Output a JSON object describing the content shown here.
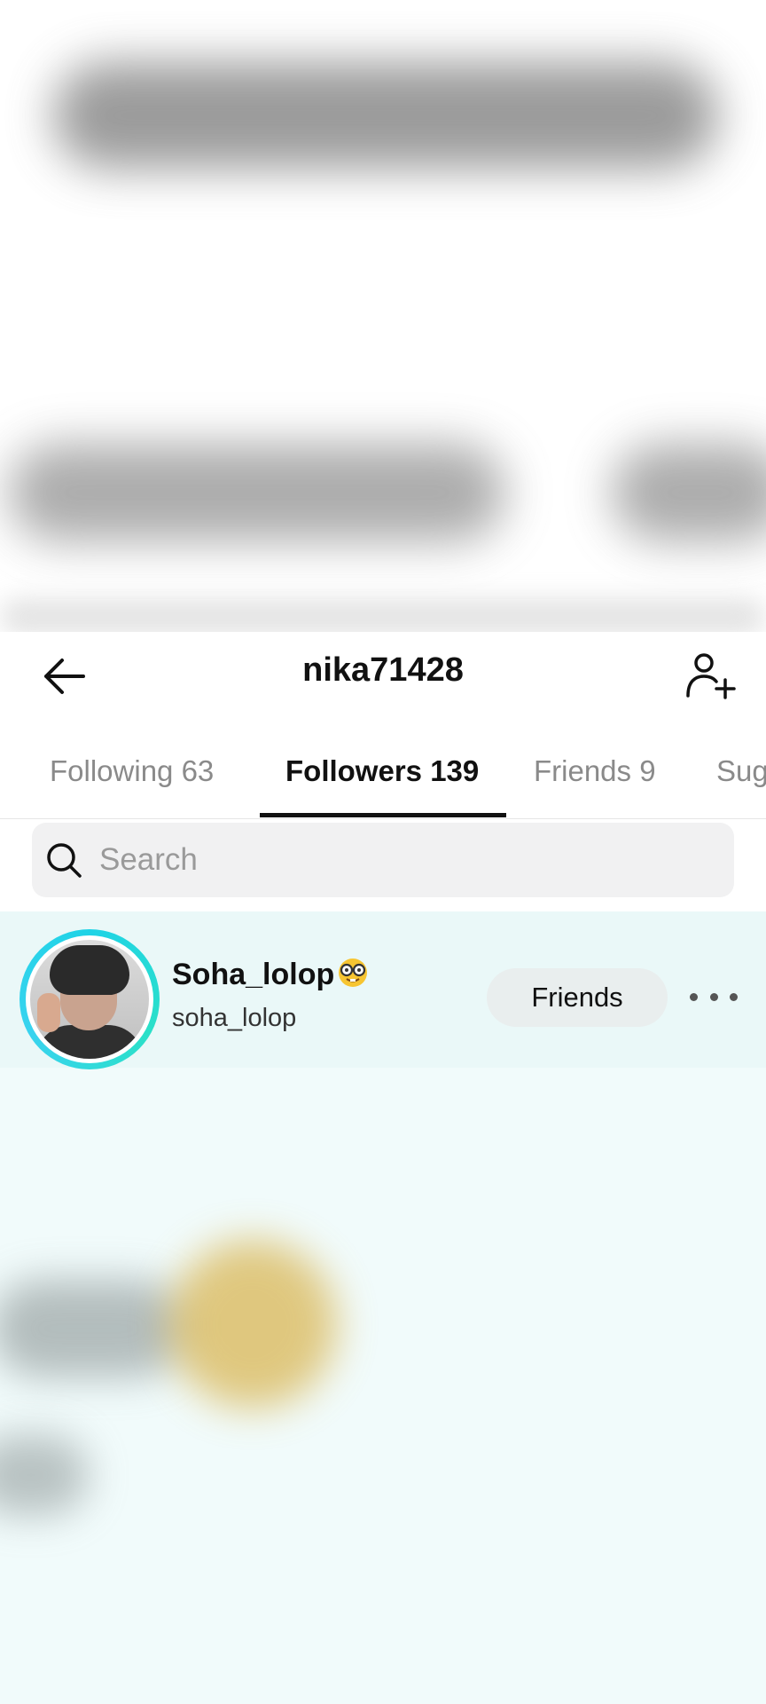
{
  "header": {
    "title": "nika71428"
  },
  "tabs": [
    {
      "label": "Following 63",
      "active": false
    },
    {
      "label": "Followers 139",
      "active": true
    },
    {
      "label": "Friends 9",
      "active": false
    },
    {
      "label": "Sug",
      "active": false
    }
  ],
  "search": {
    "placeholder": "Search"
  },
  "followers": [
    {
      "display_name": "Soha_lolop",
      "username": "soha_lolop",
      "button_label": "Friends"
    }
  ],
  "colors": {
    "story_ring": "#1fd3e6",
    "list_background": "#f1fbfb"
  },
  "icons": [
    "back-arrow-icon",
    "add-user-icon",
    "search-icon",
    "nerd-face-emoji",
    "more-options-icon"
  ]
}
